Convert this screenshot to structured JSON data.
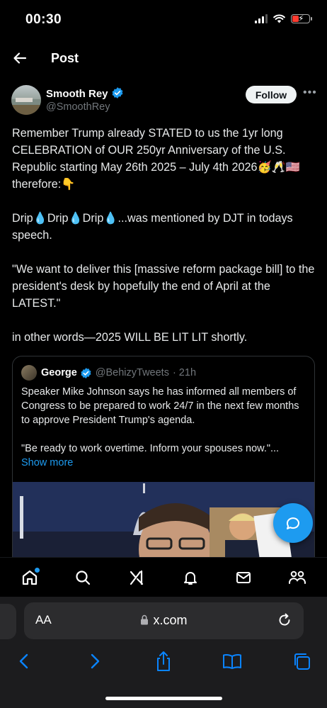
{
  "status_bar": {
    "time": "00:30"
  },
  "header": {
    "title": "Post"
  },
  "author": {
    "name": "Smooth Rey",
    "handle": "@SmoothRey",
    "follow_label": "Follow"
  },
  "post": {
    "paragraphs": [
      "Remember Trump already STATED to us the 1yr long CELEBRATION of OUR 250yr Anniversary of the U.S. Republic starting May 26th 2025 – July 4th 2026🥳🥂🇺🇸 therefore:👇",
      "Drip💧Drip💧Drip💧...was mentioned by DJT in todays speech.",
      " \"We want to deliver this [massive reform package bill] to the president's desk by hopefully the end of April at the LATEST.\"",
      "in other words—2025 WILL BE LIT LIT shortly."
    ]
  },
  "quote": {
    "name": "George",
    "handle": "@BehizyTweets",
    "time": "· 21h",
    "text1": "Speaker Mike Johnson says he has informed all members of Congress to be prepared to work 24/7 in the next few months to approve President Trump's agenda.",
    "text2": "\"Be ready to work overtime. Inform your spouses now.\"...",
    "show_more": "Show more"
  },
  "safari": {
    "aa": "AA",
    "url": "x.com"
  },
  "colors": {
    "accent": "#1d9bf0",
    "background": "#000000",
    "muted": "#71767b"
  },
  "icons": [
    "back-arrow-icon",
    "verified-badge-icon",
    "more-icon",
    "compose-icon",
    "home-icon",
    "search-icon",
    "grok-icon",
    "notifications-icon",
    "messages-icon",
    "communities-icon",
    "lock-icon",
    "reload-icon",
    "back-icon",
    "forward-icon",
    "share-icon",
    "bookmarks-icon",
    "tabs-icon"
  ]
}
